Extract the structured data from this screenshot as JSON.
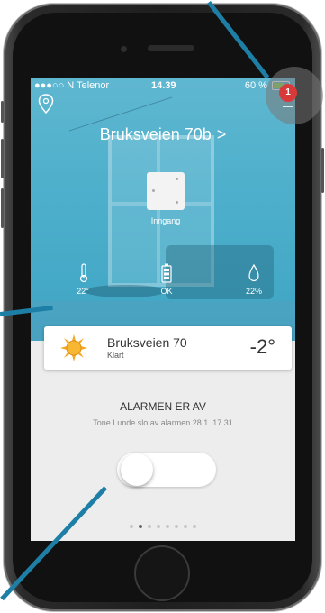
{
  "status_bar": {
    "carrier": "●●●○○ N Telenor",
    "time": "14.39",
    "battery": "60 %"
  },
  "header": {
    "title": "Bruksveien 70b",
    "chevron": ">"
  },
  "device": {
    "label": "Inngang"
  },
  "sensors": [
    {
      "icon": "thermometer-icon",
      "value": "22°"
    },
    {
      "icon": "battery-icon",
      "value": "OK"
    },
    {
      "icon": "drop-icon",
      "value": "22%"
    }
  ],
  "weather": {
    "name": "Bruksveien 70",
    "condition": "Klart",
    "temperature": "-2°",
    "icon": "sun-icon"
  },
  "alarm": {
    "title": "ALARMEN ER AV",
    "subtitle": "Tone Lunde slo av alarmen 28.1. 17.31",
    "state": "off"
  },
  "notifications": {
    "count": "1"
  },
  "pager": {
    "total": 8,
    "active_index": 1
  },
  "colors": {
    "accent": "#4fb0cc",
    "badge": "#d83a3a",
    "pointer": "#1e7fa6"
  }
}
